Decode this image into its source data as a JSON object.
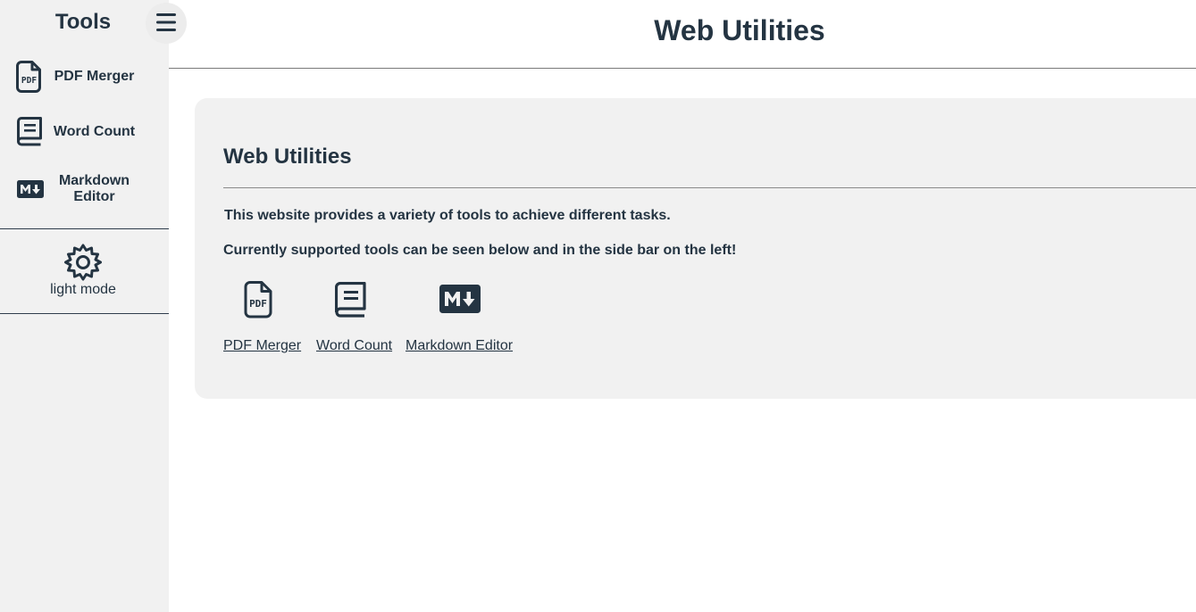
{
  "sidebar": {
    "title": "Tools",
    "menu_icon": "hamburger-menu-icon",
    "items": [
      {
        "label": "PDF Merger",
        "icon": "pdf-file-icon"
      },
      {
        "label": "Word Count",
        "icon": "book-icon"
      },
      {
        "label": "Markdown Editor",
        "icon": "markdown-icon"
      }
    ],
    "theme_toggle": {
      "label": "light mode",
      "icon": "gear-icon"
    }
  },
  "header": {
    "title": "Web Utilities"
  },
  "main": {
    "title": "Web Utilities",
    "paragraphs": [
      "This website provides a variety of tools to achieve different tasks.",
      "Currently supported tools can be seen below and in the side bar on the left!"
    ],
    "tools": [
      {
        "label": "PDF Merger",
        "icon": "pdf-file-icon"
      },
      {
        "label": "Word Count",
        "icon": "book-icon"
      },
      {
        "label": "Markdown Editor",
        "icon": "markdown-icon"
      }
    ]
  },
  "colors": {
    "text": "#243442",
    "sidebar_bg": "#f1f1f1",
    "card_bg": "#f1f1f1",
    "page_bg": "#ffffff"
  }
}
